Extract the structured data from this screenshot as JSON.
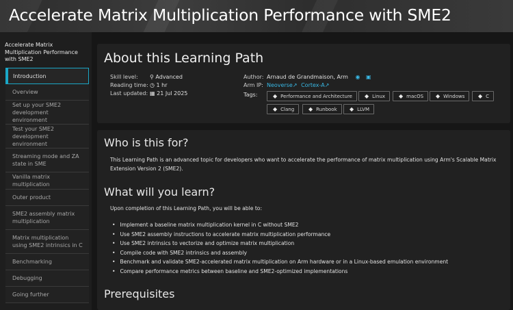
{
  "banner": {
    "title": "Accelerate Matrix Multiplication Performance with SME2"
  },
  "sidebar": {
    "heading": "Accelerate Matrix Multiplication Performance with SME2",
    "items": [
      {
        "label": "Introduction"
      },
      {
        "label": "Overview"
      },
      {
        "label": "Set up your SME2 development environment"
      },
      {
        "label": "Test your SME2 development environment"
      },
      {
        "label": "Streaming mode and ZA state in SME"
      },
      {
        "label": "Vanilla matrix multiplication"
      },
      {
        "label": "Outer product"
      },
      {
        "label": "SME2 assembly matrix multiplication"
      },
      {
        "label": "Matrix multiplication using SME2 intrinsics in C"
      },
      {
        "label": "Benchmarking"
      },
      {
        "label": "Debugging"
      },
      {
        "label": "Going further"
      }
    ]
  },
  "about": {
    "title": "About this Learning Path",
    "skill_label": "Skill level:",
    "skill_value": "Advanced",
    "time_label": "Reading time:",
    "time_value": "1 hr",
    "updated_label": "Last updated:",
    "updated_value": "21 Jul 2025",
    "author_label": "Author:",
    "author_value": "Arnaud de Grandmaison, Arm",
    "armip_label": "Arm IP:",
    "armip_1": "Neoverse",
    "armip_2": "Cortex-A",
    "tags_label": "Tags:",
    "tags": [
      "Performance and Architecture",
      "Linux",
      "macOS",
      "Windows",
      "C",
      "Clang",
      "Runbook",
      "LLVM"
    ]
  },
  "who": {
    "title": "Who is this for?",
    "text": "This Learning Path is an advanced topic for developers who want to accelerate the performance of matrix multiplication using Arm's Scalable Matrix Extension Version 2 (SME2)."
  },
  "learn": {
    "title": "What will you learn?",
    "intro": "Upon completion of this Learning Path, you will be able to:",
    "bullets": [
      "Implement a baseline matrix multiplication kernel in C without SME2",
      "Use SME2 assembly instructions to accelerate matrix multiplication performance",
      "Use SME2 intrinsics to vectorize and optimize matrix multiplication",
      "Compile code with SME2 intrinsics and assembly",
      "Benchmark and validate SME2-accelerated matrix multiplication on Arm hardware or in a Linux-based emulation environment",
      "Compare performance metrics between baseline and SME2-optimized implementations"
    ]
  },
  "prereq": {
    "title": "Prerequisites"
  },
  "colors": {
    "accent": "#1aa7c7",
    "link": "#39b9e6"
  }
}
